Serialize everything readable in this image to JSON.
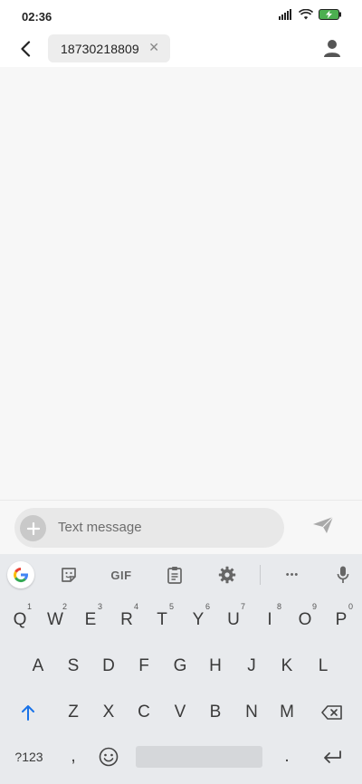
{
  "status_bar": {
    "time": "02:36",
    "icons": [
      "signal-icon",
      "wifi-icon",
      "battery-charging-icon"
    ],
    "battery_color": "#4caf50"
  },
  "header": {
    "back_icon": "back-arrow-icon",
    "recipient": "18730218809",
    "remove_icon": "close-icon",
    "contact_icon": "person-icon"
  },
  "compose": {
    "placeholder": "Text message",
    "add_icon": "plus-icon",
    "send_icon": "send-icon"
  },
  "keyboard": {
    "toolbar": [
      "google-icon",
      "sticker-icon",
      "GIF",
      "clipboard-icon",
      "settings-icon",
      "more-icon",
      "mic-icon"
    ],
    "gif_label": "GIF",
    "more_label": "•••",
    "row1": [
      {
        "label": "Q",
        "hint": "1"
      },
      {
        "label": "W",
        "hint": "2"
      },
      {
        "label": "E",
        "hint": "3"
      },
      {
        "label": "R",
        "hint": "4"
      },
      {
        "label": "T",
        "hint": "5"
      },
      {
        "label": "Y",
        "hint": "6"
      },
      {
        "label": "U",
        "hint": "7"
      },
      {
        "label": "I",
        "hint": "8"
      },
      {
        "label": "O",
        "hint": "9"
      },
      {
        "label": "P",
        "hint": "0"
      }
    ],
    "row2": [
      "A",
      "S",
      "D",
      "F",
      "G",
      "H",
      "J",
      "K",
      "L"
    ],
    "row3": [
      "Z",
      "X",
      "C",
      "V",
      "B",
      "N",
      "M"
    ],
    "row4": {
      "symbols": "?123",
      "comma": ",",
      "period": ".",
      "emoji_icon": "emoji-icon",
      "enter_icon": "enter-icon"
    },
    "accent_color": "#1a73e8"
  }
}
